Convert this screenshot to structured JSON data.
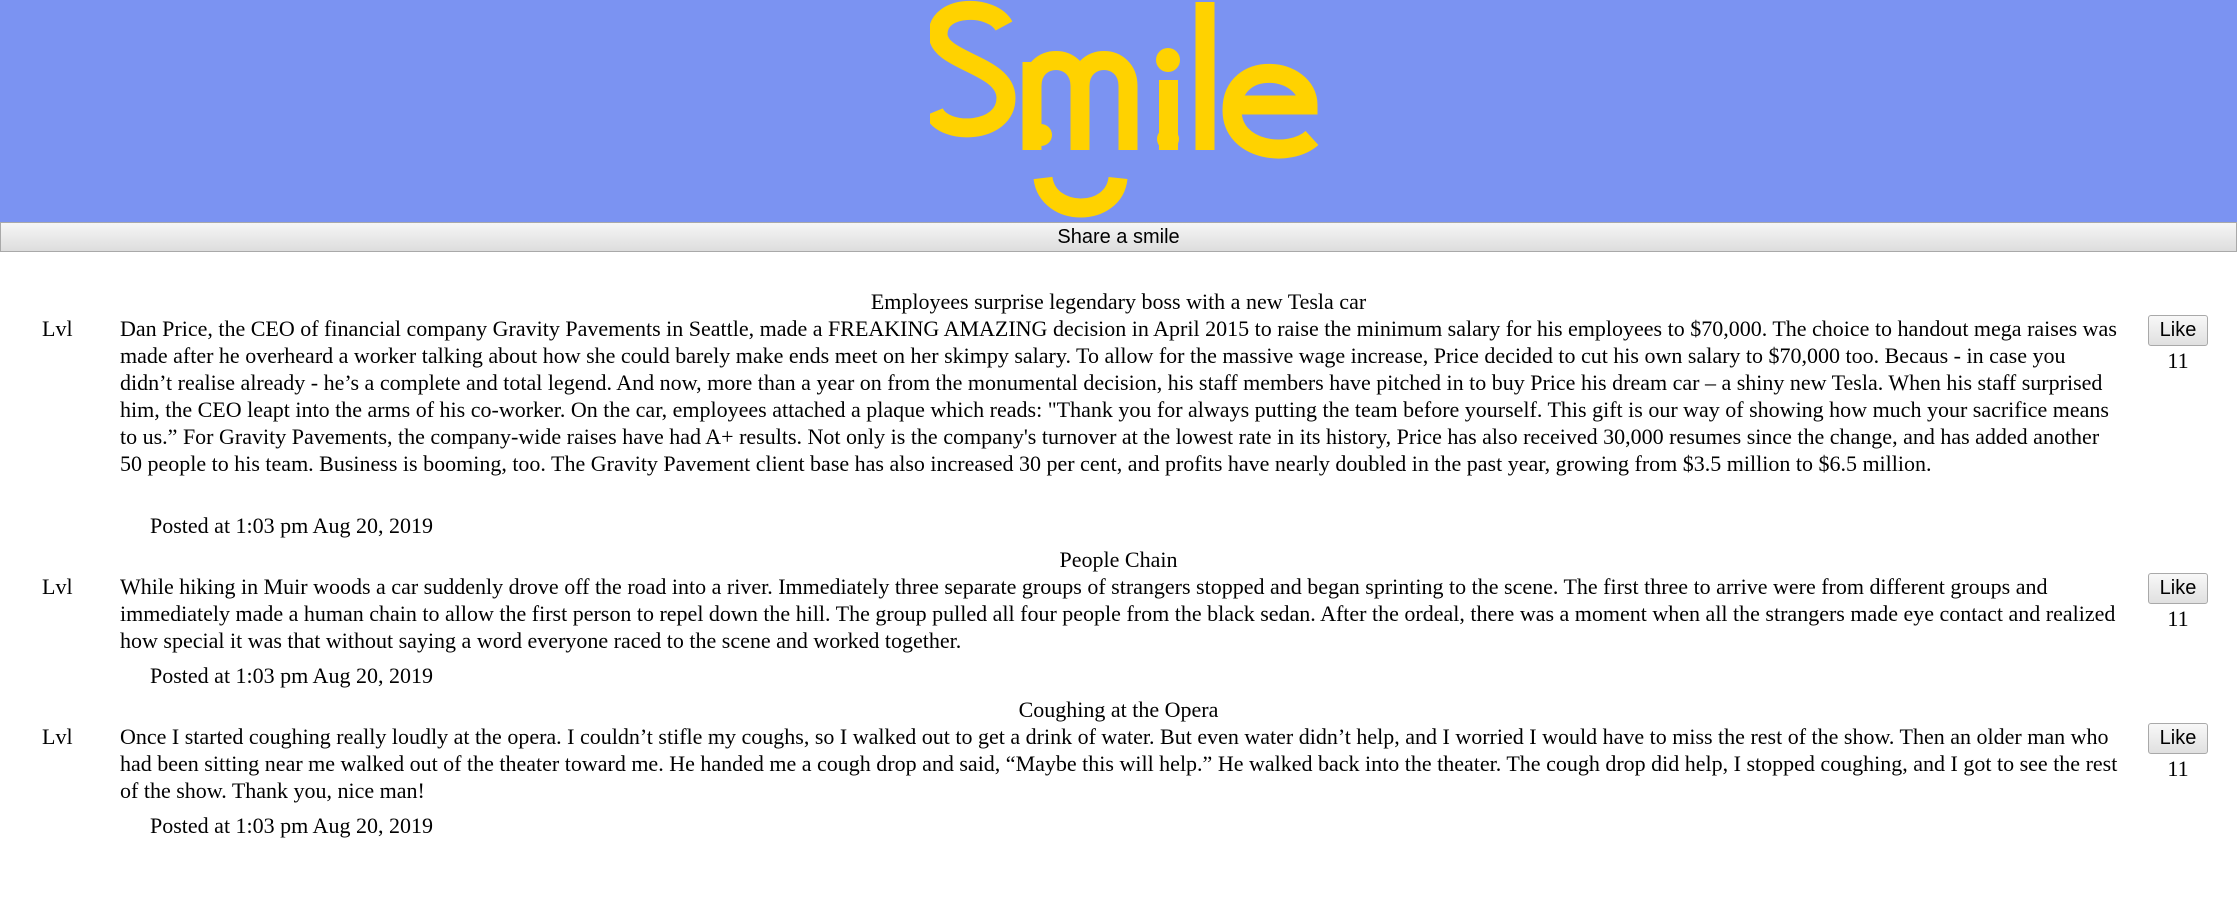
{
  "header": {
    "logo_text": "Smile",
    "colors": {
      "background": "#7b93f2",
      "logo": "#ffd200"
    }
  },
  "share_button_label": "Share a smile",
  "posts": [
    {
      "title": "Employees surprise legendary boss with a new Tesla car",
      "level": "Lvl",
      "body": "Dan Price, the CEO of financial company Gravity Pavements in Seattle, made a FREAKING AMAZING decision in April 2015 to raise the minimum salary for his employees to $70,000. The choice to handout mega raises was made after he overheard a worker talking about how she could barely make ends meet on her skimpy salary. To allow for the massive wage increase, Price decided to cut his own salary to $70,000 too. Becaus - in case you didn’t realise already - he’s a complete and total legend. And now, more than a year on from the monumental decision, his staff members have pitched in to buy Price his dream car – a shiny new Tesla. When his staff surprised him, the CEO leapt into the arms of his co-worker. On the car, employees attached a plaque which reads: \"Thank you for always putting the team before yourself. This gift is our way of showing how much your sacrifice means to us.” For Gravity Pavements, the company-wide raises have had A+ results. Not only is the company's turnover at the lowest rate in its history, Price has also received 30,000 resumes since the change, and has added another 50 people to his team. Business is booming, too. The Gravity Pavement client base has also increased 30 per cent, and profits have nearly doubled in the past year, growing from $3.5 million to $6.5 million.",
      "posted": "Posted at 1:03 pm Aug 20, 2019",
      "like_label": "Like",
      "likes": "11"
    },
    {
      "title": "People Chain",
      "level": "Lvl",
      "body": "While hiking in Muir woods a car suddenly drove off the road into a river. Immediately three separate groups of strangers stopped and began sprinting to the scene. The first three to arrive were from different groups and immediately made a human chain to allow the first person to repel down the hill. The group pulled all four people from the black sedan. After the ordeal, there was a moment when all the strangers made eye contact and realized how special it was that without saying a word everyone raced to the scene and worked together.",
      "posted": "Posted at 1:03 pm Aug 20, 2019",
      "like_label": "Like",
      "likes": "11"
    },
    {
      "title": "Coughing at the Opera",
      "level": "Lvl",
      "body": "Once I started coughing really loudly at the opera. I couldn’t stifle my coughs, so I walked out to get a drink of water. But even water didn’t help, and I worried I would have to miss the rest of the show. Then an older man who had been sitting near me walked out of the theater toward me. He handed me a cough drop and said, “Maybe this will help.” He walked back into the theater. The cough drop did help, I stopped coughing, and I got to see the rest of the show. Thank you, nice man!",
      "posted": "Posted at 1:03 pm Aug 20, 2019",
      "like_label": "Like",
      "likes": "11"
    }
  ]
}
